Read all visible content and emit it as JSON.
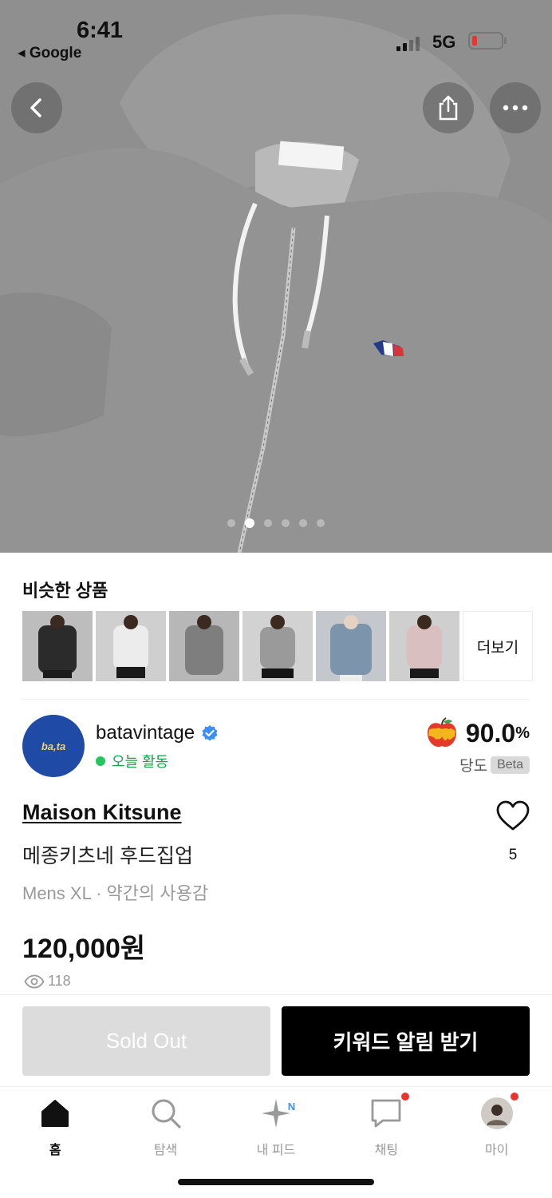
{
  "status_bar": {
    "time": "6:41",
    "back_app": "◂ Google",
    "network": "5G"
  },
  "hero": {
    "image_alt": "grey zip-up hoodie with small fox logo",
    "active_index": 1,
    "dot_count": 6
  },
  "similar": {
    "title": "비슷한 상품",
    "more_label": "더보기",
    "thumbs": [
      "dark",
      "white",
      "grey",
      "grey-light",
      "blue",
      "pink"
    ]
  },
  "seller": {
    "name": "batavintage",
    "avatar_text": "ba,ta",
    "activity": "오늘 활동",
    "sweetness_value": "90.0",
    "sweetness_unit": "%",
    "sweetness_label": "당도",
    "beta": "Beta"
  },
  "product": {
    "brand": "Maison Kitsune",
    "name": "메종키츠네 후드집업",
    "meta": "Mens XL · 약간의 사용감",
    "price": "120,000원",
    "likes": "5",
    "views": "118"
  },
  "actions": {
    "sold_out": "Sold Out",
    "keyword_alert": "키워드 알림 받기"
  },
  "tabs": [
    {
      "label": "홈",
      "icon": "home-icon",
      "active": true
    },
    {
      "label": "탐색",
      "icon": "search-icon"
    },
    {
      "label": "내 피드",
      "icon": "sparkle-icon",
      "badge": "N"
    },
    {
      "label": "채팅",
      "icon": "chat-icon"
    },
    {
      "label": "마이",
      "icon": "profile-icon"
    }
  ],
  "colors": {
    "accent_green": "#1aa34a",
    "sold_out_bg": "#dcdcdc",
    "primary_btn": "#000000",
    "badge_red": "#e8352f",
    "verified_blue": "#3d8ff5"
  }
}
